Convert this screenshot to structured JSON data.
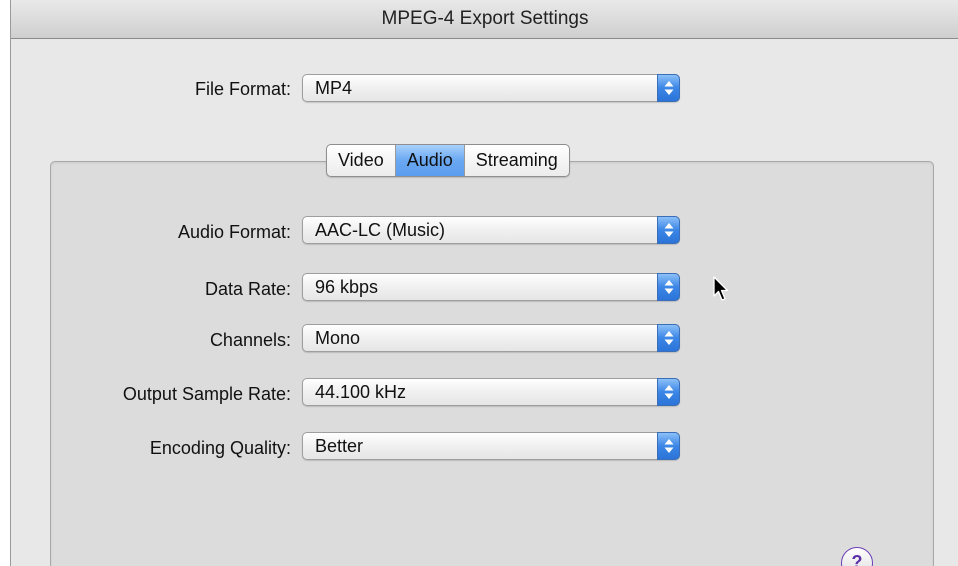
{
  "window": {
    "title": "MPEG-4 Export Settings"
  },
  "file_format": {
    "label": "File Format:",
    "value": "MP4"
  },
  "tabs": [
    {
      "label": "Video",
      "active": false
    },
    {
      "label": "Audio",
      "active": true
    },
    {
      "label": "Streaming",
      "active": false
    }
  ],
  "audio": {
    "format": {
      "label": "Audio Format:",
      "value": "AAC-LC (Music)"
    },
    "data_rate": {
      "label": "Data Rate:",
      "value": "96 kbps"
    },
    "channels": {
      "label": "Channels:",
      "value": "Mono"
    },
    "sample_rate": {
      "label": "Output Sample Rate:",
      "value": "44.100 kHz"
    },
    "quality": {
      "label": "Encoding Quality:",
      "value": "Better"
    }
  },
  "help": {
    "glyph": "?"
  },
  "colors": {
    "popup_arrow_blue": "#3b86e6",
    "active_tab_blue": "#6aa8f2",
    "help_purple": "#6c3fb6"
  }
}
